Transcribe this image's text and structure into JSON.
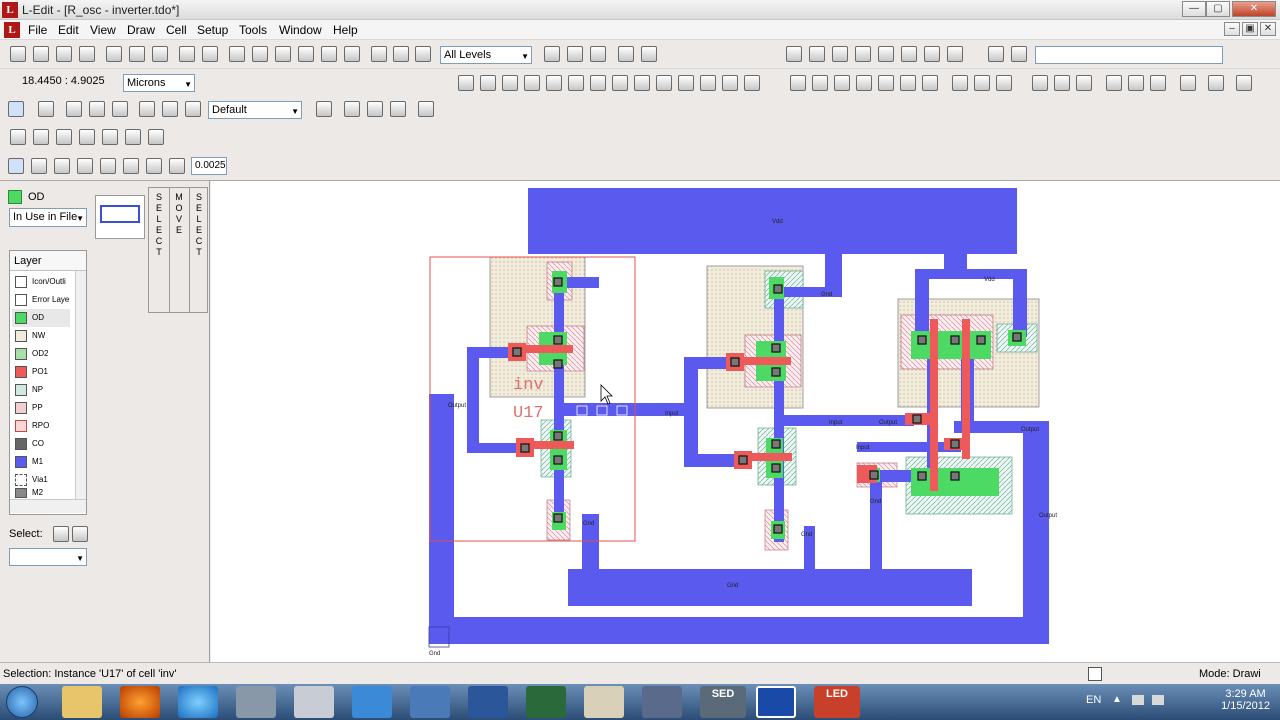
{
  "window": {
    "title": "L-Edit - [R_osc - inverter.tdo*]",
    "app_icon_letter": "L",
    "min_btn": "—",
    "max_btn": "▢",
    "close_btn": "✕",
    "child_min": "–",
    "child_restore": "▣",
    "child_close": "✕"
  },
  "menu": [
    "File",
    "Edit",
    "View",
    "Draw",
    "Cell",
    "Setup",
    "Tools",
    "Window",
    "Help"
  ],
  "toolbar": {
    "levels_select": "All Levels",
    "units_select": "Microns",
    "coordinates": "18.4450 : 4.9025",
    "style_select": "Default",
    "snap_value": "0.0025",
    "search_value": ""
  },
  "left_panel": {
    "current_layer": "OD",
    "filter_select": "In Use in File",
    "layer_header": "Layer",
    "layers": [
      {
        "name": "Icon/Outli",
        "color": "#ffffff"
      },
      {
        "name": "Error Laye",
        "color": "#ffffff"
      },
      {
        "name": "OD",
        "color": "#4cd964"
      },
      {
        "name": "NW",
        "color": "#f0ead8"
      },
      {
        "name": "OD2",
        "color": "#a6e0a6"
      },
      {
        "name": "PO1",
        "color": "#ee5a5a"
      },
      {
        "name": "NP",
        "color": "#cfe8e0"
      },
      {
        "name": "PP",
        "color": "#f2cdd2"
      },
      {
        "name": "RPO",
        "color": "#f6d6d6"
      },
      {
        "name": "CO",
        "color": "#666666"
      },
      {
        "name": "M1",
        "color": "#5a5aee"
      },
      {
        "name": "Via1",
        "color": "#ffffff"
      },
      {
        "name": "M2",
        "color": "#888888"
      }
    ],
    "select_label": "Select:",
    "mode_letters_select": [
      "S",
      "E",
      "L",
      "E",
      "C",
      "T"
    ],
    "mode_letters_move": [
      "M",
      "O",
      "V",
      "E"
    ],
    "mode_letters_select2": [
      "S",
      "E",
      "L",
      "E",
      "C",
      "T"
    ]
  },
  "canvas": {
    "instance_name": "inv",
    "instance_id": "U17",
    "labels": [
      "Vdd",
      "Output",
      "Input",
      "Gnd",
      "Gnd",
      "Gnd",
      "Input",
      "Output",
      "Input",
      "Vdd",
      "Gnd",
      "Gnd",
      "Output",
      "Gnd",
      "Output"
    ]
  },
  "status": {
    "selection": "Selection: Instance 'U17' of cell 'inv'",
    "mode": "Mode: Drawi"
  },
  "taskbar": {
    "time": "3:29 AM",
    "date": "1/15/2012",
    "lang": "EN",
    "tasks": [
      "SED",
      "LED"
    ]
  }
}
